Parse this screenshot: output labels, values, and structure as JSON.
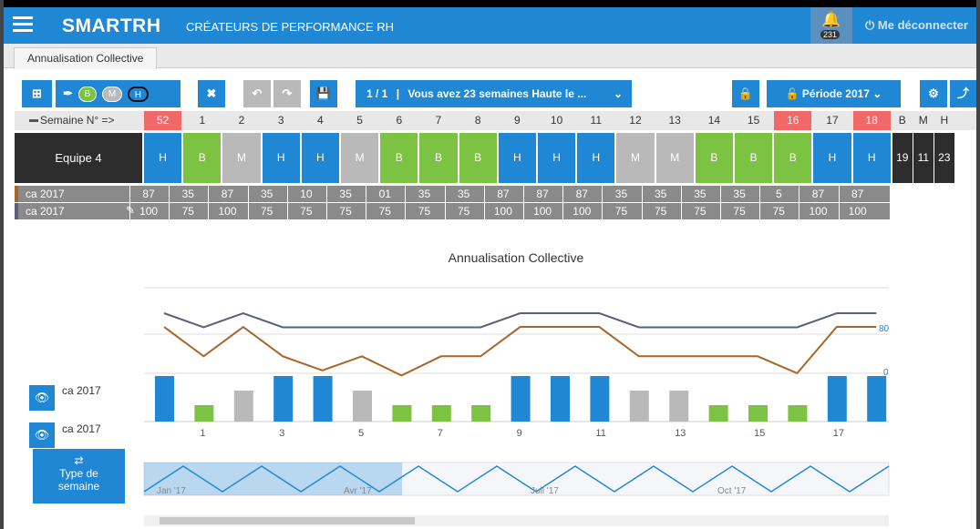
{
  "header": {
    "logo_prefix": "SMART",
    "logo_suffix": "RH",
    "tagline": "CRÉATEURS DE PERFORMANCE RH",
    "notification_count": "231",
    "logout_label": "Me déconnecter"
  },
  "tabs": [
    {
      "label": "Annualisation Collective"
    }
  ],
  "toolbar": {
    "pill_b": "B",
    "pill_m": "M",
    "pill_h": "H",
    "page_counter": "1 / 1",
    "message": "Vous avez 23 semaines Haute le ...",
    "period_label": "Période 2017"
  },
  "grid": {
    "week_header_label": "Semaine N° =>",
    "weeks": [
      "52",
      "1",
      "2",
      "3",
      "4",
      "5",
      "6",
      "7",
      "8",
      "9",
      "10",
      "11",
      "12",
      "13",
      "14",
      "15",
      "16",
      "17",
      "18"
    ],
    "highlighted_weeks": [
      "52",
      "16",
      "18"
    ],
    "totals_header": [
      "B",
      "M",
      "H"
    ],
    "team_name": "Equipe 4",
    "team_types": [
      "H",
      "B",
      "M",
      "H",
      "H",
      "M",
      "B",
      "B",
      "B",
      "H",
      "H",
      "H",
      "M",
      "M",
      "B",
      "B",
      "B",
      "H",
      "H"
    ],
    "totals": [
      "19",
      "11",
      "23"
    ],
    "rows": [
      {
        "label": "ca 2017",
        "values": [
          "87",
          "35",
          "87",
          "35",
          "10",
          "35",
          "01",
          "35",
          "35",
          "87",
          "87",
          "87",
          "35",
          "35",
          "35",
          "35",
          "5",
          "87",
          "87"
        ]
      },
      {
        "label": "ca 2017",
        "values": [
          "100",
          "75",
          "100",
          "75",
          "75",
          "75",
          "75",
          "75",
          "75",
          "100",
          "100",
          "100",
          "75",
          "75",
          "75",
          "75",
          "75",
          "100",
          "100"
        ]
      }
    ]
  },
  "chart": {
    "title": "Annualisation Collective",
    "axis_right": [
      "80",
      "0"
    ],
    "x_ticks": [
      "1",
      "3",
      "5",
      "7",
      "9",
      "11",
      "13",
      "15",
      "17"
    ],
    "nav_labels": [
      "Jan '17",
      "Avr '17",
      "Juil '17",
      "Oct '17"
    ],
    "legend": [
      {
        "label": "ca 2017"
      },
      {
        "label": "ca 2017"
      }
    ],
    "type_button": [
      "Type de",
      "semaine"
    ]
  },
  "colors": {
    "blue": "#1f87d3",
    "green": "#7cc243",
    "grey": "#b9b9b9",
    "red": "#f06868",
    "dark": "#2d2d2d",
    "line_dark": "#5a6079",
    "line_brown": "#a8662a"
  },
  "chart_data": {
    "type": "bar",
    "title": "Annualisation Collective",
    "categories": [
      "52",
      "1",
      "2",
      "3",
      "4",
      "5",
      "6",
      "7",
      "8",
      "9",
      "10",
      "11",
      "12",
      "13",
      "14",
      "15",
      "16",
      "17",
      "18"
    ],
    "series": [
      {
        "name": "ca 2017",
        "type": "line",
        "values": [
          87,
          35,
          87,
          35,
          10,
          35,
          1,
          35,
          35,
          87,
          87,
          87,
          35,
          35,
          35,
          35,
          5,
          87,
          87
        ]
      },
      {
        "name": "ca 2017",
        "type": "line",
        "values": [
          100,
          75,
          100,
          75,
          75,
          75,
          75,
          75,
          75,
          100,
          100,
          100,
          75,
          75,
          75,
          75,
          75,
          100,
          100
        ]
      }
    ],
    "bar_types": [
      "H",
      "B",
      "M",
      "H",
      "H",
      "M",
      "B",
      "B",
      "B",
      "H",
      "H",
      "H",
      "M",
      "M",
      "B",
      "B",
      "B",
      "H",
      "H"
    ]
  }
}
